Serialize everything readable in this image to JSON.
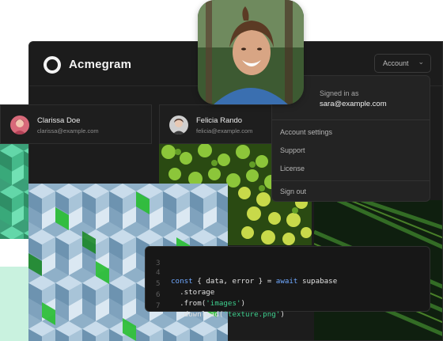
{
  "app": {
    "brand": "Acmegram",
    "account_button": "Account"
  },
  "dropdown": {
    "signed_in_label": "Signed in as",
    "email": "sara@example.com",
    "items": [
      "Account settings",
      "Support",
      "License",
      "Sign out"
    ]
  },
  "cards": [
    {
      "name": "Clarissa Doe",
      "email": "clarissa@example.com"
    },
    {
      "name": "Felicia Rando",
      "email": "felicia@example.com"
    }
  ],
  "code": {
    "line_numbers": [
      "3",
      "4",
      "5",
      "6",
      "7"
    ],
    "line1": "",
    "line2_const": "const",
    "line2_mid": " { data, error } = ",
    "line2_await": "await",
    "line2_end": " supabase",
    "line3": "  .storage",
    "line4_start": "  .from(",
    "line4_str": "'images'",
    "line4_end": ")",
    "line5_start": "  .download(",
    "line5_str": "'texture.png'",
    "line5_end": ")"
  },
  "colors": {
    "accent": "#3ecf8e",
    "background": "#1c1c1c",
    "keyword": "#6fa8ff"
  },
  "icons": {
    "logo": "ring-logo-icon",
    "chevron": "chevron-down-icon"
  }
}
